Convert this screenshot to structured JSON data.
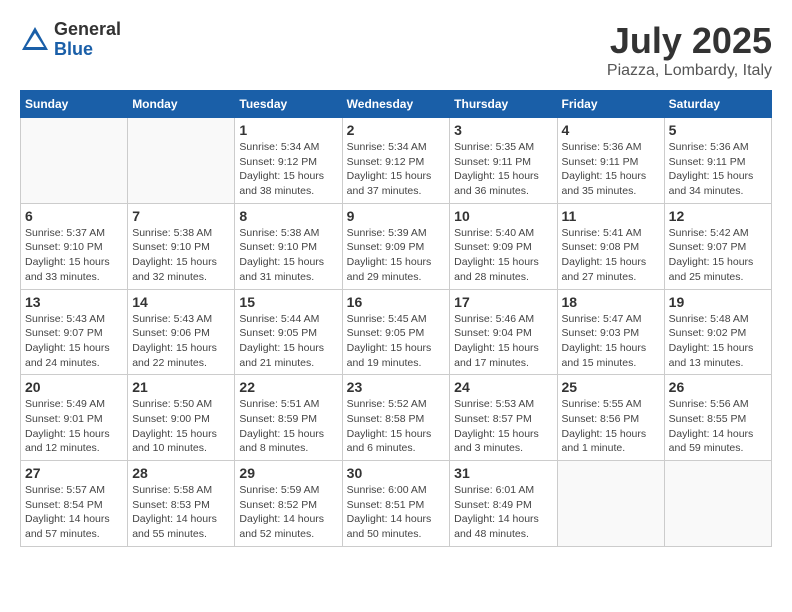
{
  "header": {
    "logo_general": "General",
    "logo_blue": "Blue",
    "month": "July 2025",
    "location": "Piazza, Lombardy, Italy"
  },
  "weekdays": [
    "Sunday",
    "Monday",
    "Tuesday",
    "Wednesday",
    "Thursday",
    "Friday",
    "Saturday"
  ],
  "weeks": [
    [
      {
        "day": "",
        "info": ""
      },
      {
        "day": "",
        "info": ""
      },
      {
        "day": "1",
        "info": "Sunrise: 5:34 AM\nSunset: 9:12 PM\nDaylight: 15 hours and 38 minutes."
      },
      {
        "day": "2",
        "info": "Sunrise: 5:34 AM\nSunset: 9:12 PM\nDaylight: 15 hours and 37 minutes."
      },
      {
        "day": "3",
        "info": "Sunrise: 5:35 AM\nSunset: 9:11 PM\nDaylight: 15 hours and 36 minutes."
      },
      {
        "day": "4",
        "info": "Sunrise: 5:36 AM\nSunset: 9:11 PM\nDaylight: 15 hours and 35 minutes."
      },
      {
        "day": "5",
        "info": "Sunrise: 5:36 AM\nSunset: 9:11 PM\nDaylight: 15 hours and 34 minutes."
      }
    ],
    [
      {
        "day": "6",
        "info": "Sunrise: 5:37 AM\nSunset: 9:10 PM\nDaylight: 15 hours and 33 minutes."
      },
      {
        "day": "7",
        "info": "Sunrise: 5:38 AM\nSunset: 9:10 PM\nDaylight: 15 hours and 32 minutes."
      },
      {
        "day": "8",
        "info": "Sunrise: 5:38 AM\nSunset: 9:10 PM\nDaylight: 15 hours and 31 minutes."
      },
      {
        "day": "9",
        "info": "Sunrise: 5:39 AM\nSunset: 9:09 PM\nDaylight: 15 hours and 29 minutes."
      },
      {
        "day": "10",
        "info": "Sunrise: 5:40 AM\nSunset: 9:09 PM\nDaylight: 15 hours and 28 minutes."
      },
      {
        "day": "11",
        "info": "Sunrise: 5:41 AM\nSunset: 9:08 PM\nDaylight: 15 hours and 27 minutes."
      },
      {
        "day": "12",
        "info": "Sunrise: 5:42 AM\nSunset: 9:07 PM\nDaylight: 15 hours and 25 minutes."
      }
    ],
    [
      {
        "day": "13",
        "info": "Sunrise: 5:43 AM\nSunset: 9:07 PM\nDaylight: 15 hours and 24 minutes."
      },
      {
        "day": "14",
        "info": "Sunrise: 5:43 AM\nSunset: 9:06 PM\nDaylight: 15 hours and 22 minutes."
      },
      {
        "day": "15",
        "info": "Sunrise: 5:44 AM\nSunset: 9:05 PM\nDaylight: 15 hours and 21 minutes."
      },
      {
        "day": "16",
        "info": "Sunrise: 5:45 AM\nSunset: 9:05 PM\nDaylight: 15 hours and 19 minutes."
      },
      {
        "day": "17",
        "info": "Sunrise: 5:46 AM\nSunset: 9:04 PM\nDaylight: 15 hours and 17 minutes."
      },
      {
        "day": "18",
        "info": "Sunrise: 5:47 AM\nSunset: 9:03 PM\nDaylight: 15 hours and 15 minutes."
      },
      {
        "day": "19",
        "info": "Sunrise: 5:48 AM\nSunset: 9:02 PM\nDaylight: 15 hours and 13 minutes."
      }
    ],
    [
      {
        "day": "20",
        "info": "Sunrise: 5:49 AM\nSunset: 9:01 PM\nDaylight: 15 hours and 12 minutes."
      },
      {
        "day": "21",
        "info": "Sunrise: 5:50 AM\nSunset: 9:00 PM\nDaylight: 15 hours and 10 minutes."
      },
      {
        "day": "22",
        "info": "Sunrise: 5:51 AM\nSunset: 8:59 PM\nDaylight: 15 hours and 8 minutes."
      },
      {
        "day": "23",
        "info": "Sunrise: 5:52 AM\nSunset: 8:58 PM\nDaylight: 15 hours and 6 minutes."
      },
      {
        "day": "24",
        "info": "Sunrise: 5:53 AM\nSunset: 8:57 PM\nDaylight: 15 hours and 3 minutes."
      },
      {
        "day": "25",
        "info": "Sunrise: 5:55 AM\nSunset: 8:56 PM\nDaylight: 15 hours and 1 minute."
      },
      {
        "day": "26",
        "info": "Sunrise: 5:56 AM\nSunset: 8:55 PM\nDaylight: 14 hours and 59 minutes."
      }
    ],
    [
      {
        "day": "27",
        "info": "Sunrise: 5:57 AM\nSunset: 8:54 PM\nDaylight: 14 hours and 57 minutes."
      },
      {
        "day": "28",
        "info": "Sunrise: 5:58 AM\nSunset: 8:53 PM\nDaylight: 14 hours and 55 minutes."
      },
      {
        "day": "29",
        "info": "Sunrise: 5:59 AM\nSunset: 8:52 PM\nDaylight: 14 hours and 52 minutes."
      },
      {
        "day": "30",
        "info": "Sunrise: 6:00 AM\nSunset: 8:51 PM\nDaylight: 14 hours and 50 minutes."
      },
      {
        "day": "31",
        "info": "Sunrise: 6:01 AM\nSunset: 8:49 PM\nDaylight: 14 hours and 48 minutes."
      },
      {
        "day": "",
        "info": ""
      },
      {
        "day": "",
        "info": ""
      }
    ]
  ]
}
